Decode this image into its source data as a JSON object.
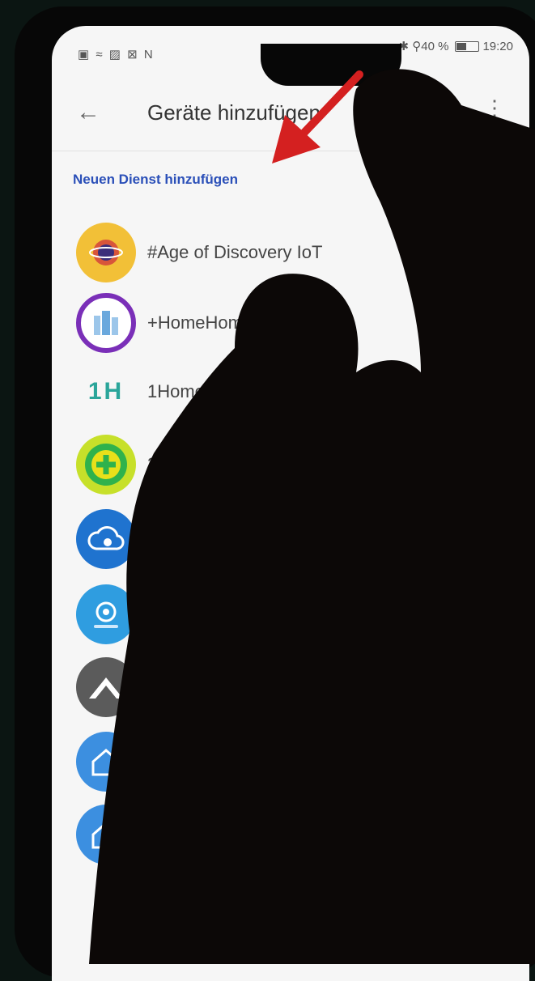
{
  "status_bar": {
    "left_icons": "▣ ≈ ▨ ⊠ N",
    "right_text": "✱ ⚲40 %",
    "time": "19:20"
  },
  "appbar": {
    "back_icon": "arrow-left-icon",
    "title": "Geräte hinzufügen",
    "more_icon": "more-vert-icon"
  },
  "section_label": "Neuen Dienst hinzufügen",
  "services": [
    {
      "label": "#Age of Discovery IoT",
      "icon": "age-of-discovery-logo-icon",
      "color": "#f2c037"
    },
    {
      "label": "+HomeHome",
      "icon": "homehome-logo-icon",
      "color": "#7a2fb8"
    },
    {
      "label": "1Home for ... one",
      "icon": "1home-logo-icon",
      "color": "#2aa59a",
      "logo_text": "1H"
    },
    {
      "label": "36",
      "icon": "360-logo-icon",
      "color": "#c7e02a"
    },
    {
      "label": "",
      "icon": "cloud-eye-logo-icon",
      "color": "#1f73cf"
    },
    {
      "label": "",
      "icon": "at-sign-logo-icon",
      "color": "#2f9de0"
    },
    {
      "label": "",
      "icon": "roof-logo-icon",
      "color": "#5b5b5b"
    },
    {
      "label": "",
      "icon": "house-logo-icon",
      "color": "#3c8fe0"
    },
    {
      "label": "",
      "icon": "house-logo-icon",
      "color": "#3c8fe0"
    }
  ],
  "annotation": {
    "arrow_color": "#d42020"
  }
}
